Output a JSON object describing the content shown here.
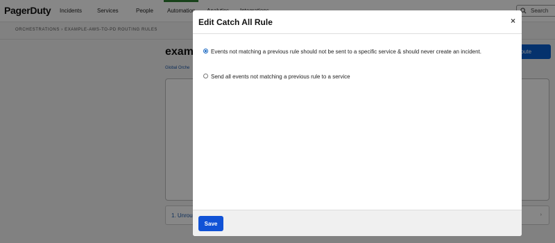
{
  "app": {
    "logo": "PagerDuty"
  },
  "nav": {
    "items": [
      {
        "label": "Incidents"
      },
      {
        "label": "Services"
      },
      {
        "label": "People"
      },
      {
        "label": "Automation"
      },
      {
        "label": "Analytics"
      },
      {
        "label": "Integrations"
      }
    ],
    "active": "Automation",
    "search_label": "Search"
  },
  "breadcrumb": "ORCHESTRATIONS  ›  EXAMPLE-AWS-TO-PD ROUTING RULES",
  "page": {
    "title": "examp",
    "global_link": "Global Orche",
    "route_button": "ce Route",
    "route_row_label": "1. Unrou",
    "route_row_chevron": "›"
  },
  "modal": {
    "title": "Edit Catch All Rule",
    "close_label": "×",
    "options": [
      {
        "label": "Events not matching a previous rule should not be sent to a specific service & should never create an incident.",
        "checked": true
      },
      {
        "label": "Send all events not matching a previous rule to a service",
        "checked": false
      }
    ],
    "save_label": "Save"
  },
  "colors": {
    "accent": "#1052d6",
    "nav_active": "#2e7d32",
    "overlay": "rgba(0,0,0,0.47)"
  }
}
